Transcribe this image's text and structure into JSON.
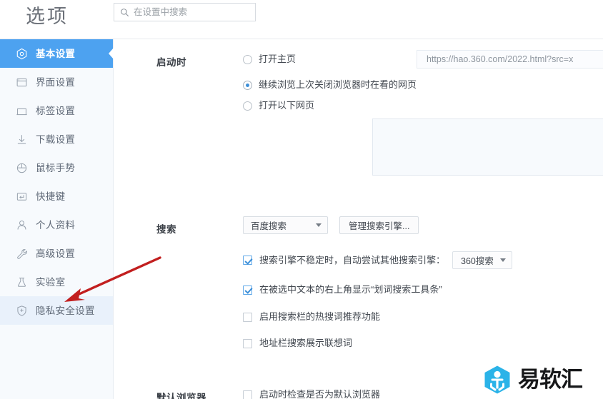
{
  "header": {
    "title": "选项",
    "search": {
      "placeholder": "在设置中搜索",
      "value": "",
      "icon": "search-icon"
    }
  },
  "sidebar": {
    "background_color": "#f7fafd",
    "active_color": "#4da2f0",
    "items": [
      {
        "label": "基本设置",
        "icon": "target-icon",
        "state": "active"
      },
      {
        "label": "界面设置",
        "icon": "window-icon",
        "state": "normal"
      },
      {
        "label": "标签设置",
        "icon": "tab-icon",
        "state": "normal"
      },
      {
        "label": "下载设置",
        "icon": "download-arrow-icon",
        "state": "normal"
      },
      {
        "label": "鼠标手势",
        "icon": "mouse-icon",
        "state": "normal"
      },
      {
        "label": "快捷键",
        "icon": "keyboard-key-icon",
        "state": "normal"
      },
      {
        "label": "个人资料",
        "icon": "person-icon",
        "state": "normal"
      },
      {
        "label": "高级设置",
        "icon": "wrench-icon",
        "state": "normal"
      },
      {
        "label": "实验室",
        "icon": "flask-icon",
        "state": "normal"
      },
      {
        "label": "隐私安全设置",
        "icon": "shield-plus-icon",
        "state": "hovered"
      }
    ]
  },
  "main": {
    "startup": {
      "section_label": "启动时",
      "radio_homepage": {
        "label": "打开主页",
        "checked": false
      },
      "homepage_url": "https://hao.360.com/2022.html?src=x",
      "radio_continue": {
        "label": "继续浏览上次关闭浏览器时在看的网页",
        "checked": true
      },
      "radio_pages": {
        "label": "打开以下网页",
        "checked": false
      },
      "pages_textarea_value": ""
    },
    "search": {
      "section_label": "搜索",
      "engine_select": {
        "value": "百度搜索",
        "caret": "chevron-down-icon"
      },
      "manage_button": "管理搜索引擎...",
      "fallback_checkbox": {
        "label": "搜索引擎不稳定时，自动尝试其他搜索引擎：",
        "checked": true
      },
      "fallback_engine": {
        "value": "360搜索",
        "caret": "chevron-down-icon"
      },
      "toolbar_checkbox": {
        "label": "在被选中文本的右上角显示“划词搜索工具条”",
        "checked": true
      },
      "hotword_checkbox": {
        "label": "启用搜索栏的热搜词推荐功能",
        "checked": false
      },
      "suggest_checkbox": {
        "label": "地址栏搜索展示联想词",
        "checked": false
      }
    },
    "default_browser": {
      "section_label": "默认浏览器",
      "check_default_checkbox": {
        "label": "启动时检查是否为默认浏览器",
        "checked": false
      }
    }
  },
  "annotation": {
    "arrow_color": "#c21f1f",
    "points_to": "隐私安全设置"
  },
  "watermark": {
    "text": "易软汇",
    "mark_color": "#2bb3e8"
  }
}
